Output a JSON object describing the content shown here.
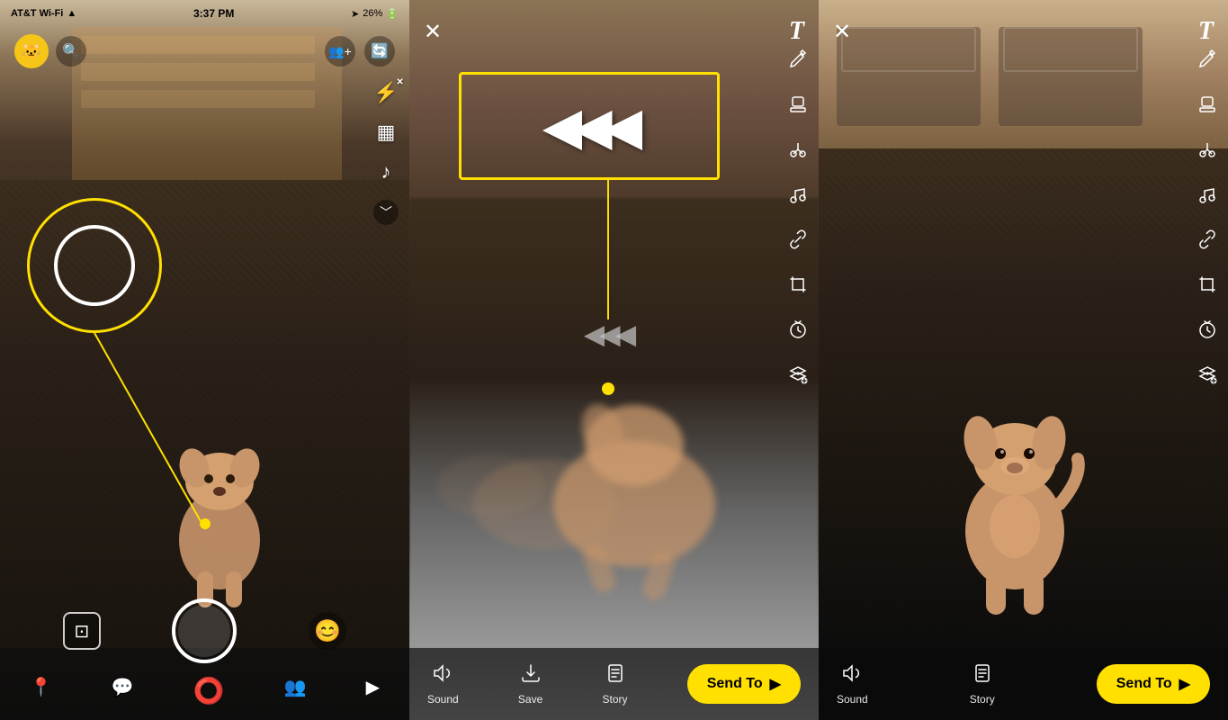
{
  "panels": {
    "camera": {
      "status": {
        "carrier": "AT&T Wi-Fi",
        "time": "3:37 PM",
        "battery": "26%"
      },
      "top_bar": {
        "add_friend_label": "＋👤",
        "flip_camera_label": "🔄"
      },
      "right_sidebar": {
        "flash_label": "⚡",
        "video_filter_label": "🎞",
        "music_label": "♪",
        "chevron_label": "﹀"
      },
      "bottom_bar": {
        "location_label": "📍",
        "chat_label": "💬",
        "camera_label": "📷",
        "friends_label": "👥",
        "play_label": "▶"
      }
    },
    "edit": {
      "top_bar": {
        "close_label": "✕",
        "text_label": "T"
      },
      "toolbar": {
        "pencil": "✏",
        "scissors": "✂",
        "music": "♪",
        "link": "🔗",
        "crop": "⤢",
        "timer": "↺",
        "layers": "⊕"
      },
      "bottom_bar": {
        "sound_label": "Sound",
        "save_label": "Save",
        "story_label": "Story",
        "send_to_label": "Send To",
        "send_to_arrow": "▶"
      }
    },
    "snap": {
      "top_bar": {
        "close_label": "✕",
        "text_label": "T"
      },
      "toolbar": {
        "pencil": "✏",
        "scissors": "✂",
        "music": "♪",
        "link": "🔗",
        "crop": "⤢",
        "timer": "↺",
        "layers": "⊕"
      },
      "bottom_bar": {
        "sound_label": "Sound",
        "story_label": "Story",
        "send_to_label": "Send To",
        "send_to_arrow": "▶"
      }
    }
  },
  "colors": {
    "yellow": "#FFE000",
    "white": "#FFFFFF",
    "dark": "#1a1a1a",
    "overlay": "rgba(0,0,0,0.5)"
  },
  "bottom_labels": {
    "sound_1": "Sound",
    "save": "Save",
    "story_1": "Story",
    "sound_2": "Sound",
    "story_2": "Story"
  }
}
